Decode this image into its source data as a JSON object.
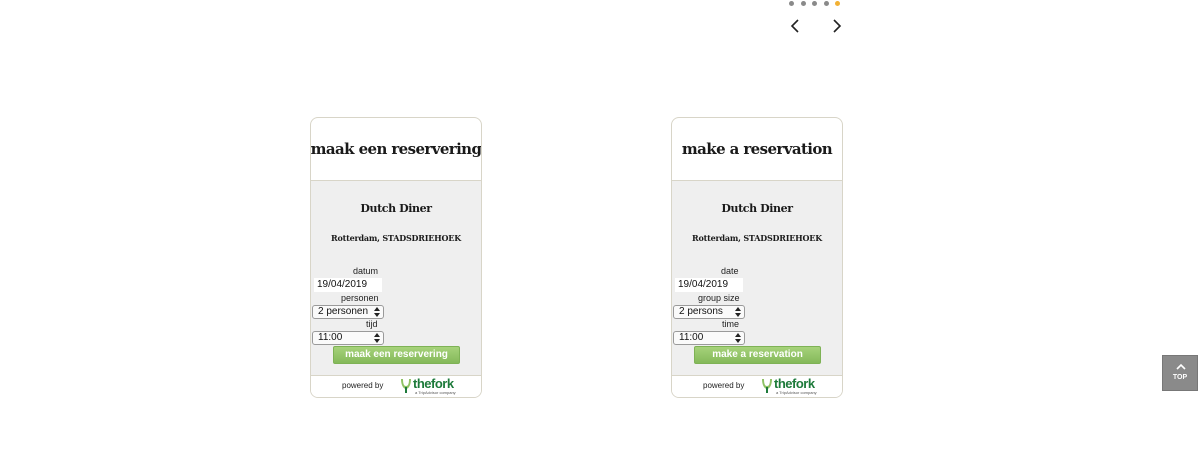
{
  "carousel": {
    "dots": 5,
    "active_index": 4,
    "active_color": "#f2b134",
    "prev_icon": "chevron-left-icon",
    "next_icon": "chevron-right-icon"
  },
  "widgets": [
    {
      "title": "maak een reservering",
      "restaurant": "Dutch Diner",
      "location": "Rotterdam, STADSDRIEHOEK",
      "date_label": "datum",
      "date_value": "19/04/2019",
      "persons_label": "personen",
      "persons_value": "2 personen",
      "time_label": "tijd",
      "time_value": "11:00",
      "submit_label": "maak een reservering",
      "powered_by": "powered by",
      "brand": "thefork",
      "brand_tagline": "a TripAdvisor company"
    },
    {
      "title": "make a reservation",
      "restaurant": "Dutch Diner",
      "location": "Rotterdam, STADSDRIEHOEK",
      "date_label": "date",
      "date_value": "19/04/2019",
      "persons_label": "group size",
      "persons_value": "2 persons",
      "time_label": "time",
      "time_value": "11:00",
      "submit_label": "make a reservation",
      "powered_by": "powered by",
      "brand": "thefork",
      "brand_tagline": "a TripAdvisor company"
    }
  ],
  "back_to_top": {
    "label": "TOP",
    "icon": "chevron-up-icon"
  },
  "colors": {
    "button_green": "#8fc265",
    "brand_green": "#1d7a3a",
    "panel_gray": "#efefef"
  }
}
